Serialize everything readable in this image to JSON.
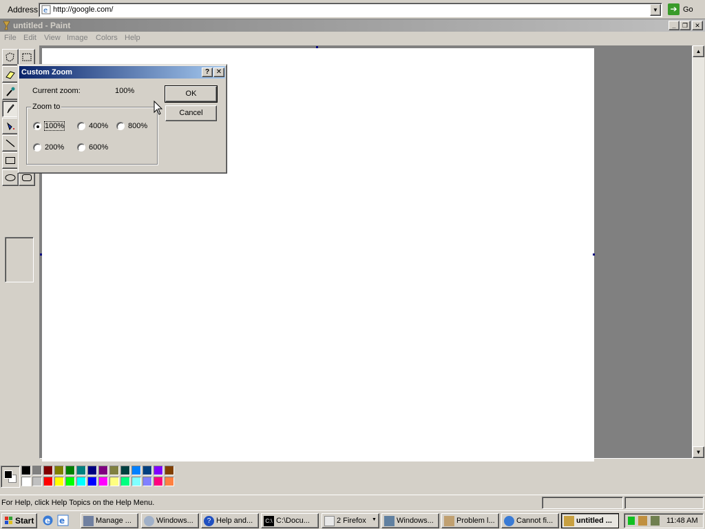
{
  "address": {
    "label": "Address",
    "value": "http://google.com/",
    "go_label": "Go"
  },
  "window": {
    "title": "untitled - Paint"
  },
  "menu": [
    "File",
    "Edit",
    "View",
    "Image",
    "Colors",
    "Help"
  ],
  "tools": [
    "free-form-select",
    "select",
    "eraser",
    "fill",
    "pick-color",
    "magnifier",
    "pencil",
    "brush",
    "airbrush",
    "text",
    "line",
    "curve",
    "rectangle",
    "polygon",
    "ellipse",
    "rounded-rectangle"
  ],
  "palette": {
    "foreground": "#000000",
    "background": "#ffffff",
    "top_row": [
      "#000000",
      "#808080",
      "#800000",
      "#808000",
      "#008000",
      "#008080",
      "#000080",
      "#800080",
      "#808040",
      "#004040",
      "#0080ff",
      "#004080",
      "#8000ff",
      "#804000"
    ],
    "bottom_row": [
      "#ffffff",
      "#c0c0c0",
      "#ff0000",
      "#ffff00",
      "#00ff00",
      "#00ffff",
      "#0000ff",
      "#ff00ff",
      "#ffff80",
      "#00ff80",
      "#80ffff",
      "#8080ff",
      "#ff0080",
      "#ff8040"
    ]
  },
  "status": {
    "text": "For Help, click Help Topics on the Help Menu."
  },
  "dialog": {
    "title": "Custom Zoom",
    "help_button": "?",
    "close_button": "✕",
    "current_zoom_label": "Current zoom:",
    "current_zoom_value": "100%",
    "group_label": "Zoom to",
    "options": [
      "100%",
      "400%",
      "800%",
      "200%",
      "600%"
    ],
    "selected": "100%",
    "ok_label": "OK",
    "cancel_label": "Cancel"
  },
  "taskbar": {
    "start_label": "Start",
    "tasks": [
      "Manage ...",
      "Windows...",
      "Help and...",
      "C:\\Docu...",
      "2 Firefox",
      "Windows...",
      "Problem l...",
      "Cannot fi...",
      "untitled ..."
    ],
    "active_task": "untitled ...",
    "clock": "11:48 AM"
  }
}
